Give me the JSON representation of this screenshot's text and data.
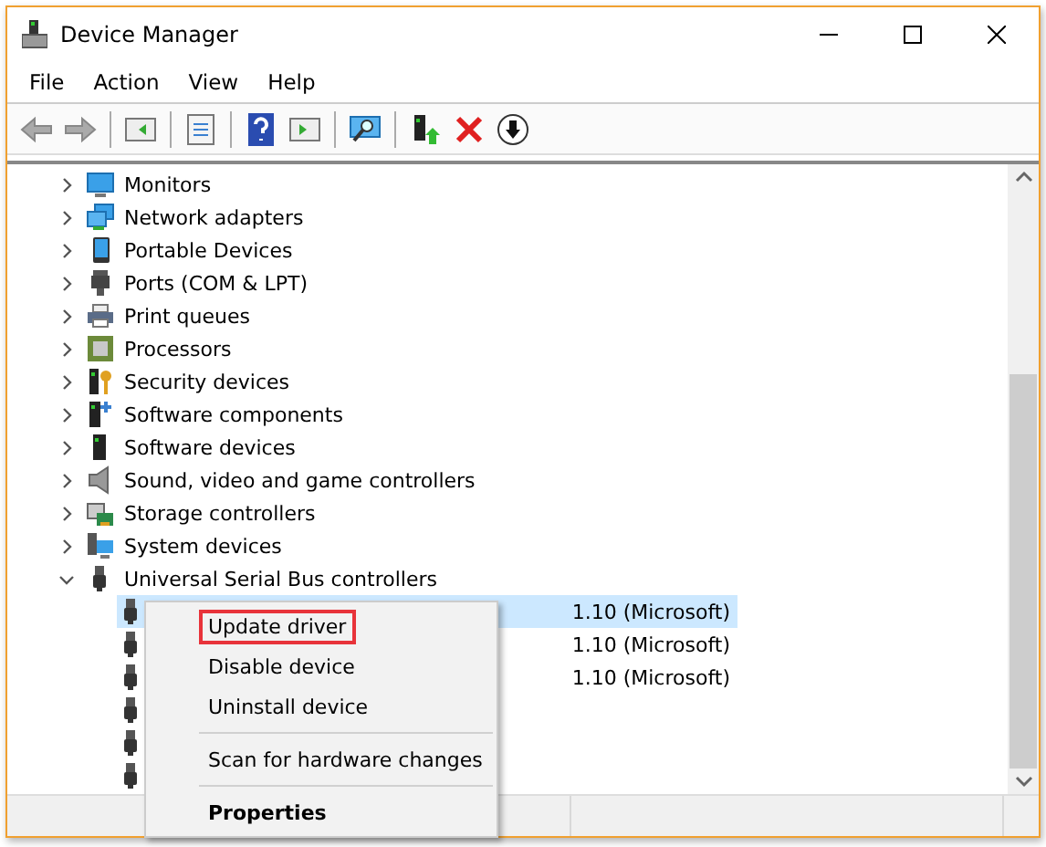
{
  "window": {
    "title": "Device Manager"
  },
  "menu": [
    "File",
    "Action",
    "View",
    "Help"
  ],
  "tree": {
    "items": [
      {
        "label": "Monitors",
        "expanded": false
      },
      {
        "label": "Network adapters",
        "expanded": false
      },
      {
        "label": "Portable Devices",
        "expanded": false
      },
      {
        "label": "Ports (COM & LPT)",
        "expanded": false
      },
      {
        "label": "Print queues",
        "expanded": false
      },
      {
        "label": "Processors",
        "expanded": false
      },
      {
        "label": "Security devices",
        "expanded": false
      },
      {
        "label": "Software components",
        "expanded": false
      },
      {
        "label": "Software devices",
        "expanded": false
      },
      {
        "label": "Sound, video and game controllers",
        "expanded": false
      },
      {
        "label": "Storage controllers",
        "expanded": false
      },
      {
        "label": "System devices",
        "expanded": false
      },
      {
        "label": "Universal Serial Bus controllers",
        "expanded": true,
        "children": [
          {
            "label": "1.10 (Microsoft)",
            "selected": true
          },
          {
            "label": "1.10 (Microsoft)",
            "selected": false
          },
          {
            "label": "1.10 (Microsoft)",
            "selected": false
          },
          {
            "selected": false
          },
          {
            "selected": false
          },
          {
            "selected": false
          }
        ]
      }
    ]
  },
  "context_menu": [
    {
      "kind": "item",
      "label": "Update driver",
      "highlighted": true
    },
    {
      "kind": "item",
      "label": "Disable device",
      "highlighted": false
    },
    {
      "kind": "item",
      "label": "Uninstall device",
      "highlighted": false
    },
    {
      "kind": "separator"
    },
    {
      "kind": "item",
      "label": "Scan for hardware changes",
      "highlighted": false
    },
    {
      "kind": "separator"
    },
    {
      "kind": "default",
      "label": "Properties",
      "highlighted": false
    }
  ]
}
